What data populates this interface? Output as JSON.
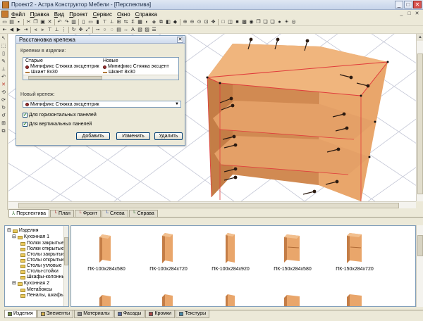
{
  "window": {
    "title": "Проект2 - Астра Конструктор Мебели - [Перспектива]",
    "buttons": {
      "minimize": "_",
      "maximize": "□",
      "close": "✕"
    }
  },
  "menu": {
    "items": [
      "Файл",
      "Правка",
      "Вид",
      "Проект",
      "Сервис",
      "Окно",
      "Справка"
    ],
    "mdi_buttons": [
      "_",
      "□",
      "✕"
    ]
  },
  "dialog": {
    "title": "Расстановка крепежа",
    "close": "✕",
    "fasteners_label": "Крепежи в изделии:",
    "columns": {
      "old": "Старые",
      "new": "Новые"
    },
    "rows": [
      {
        "old": "Минификс Стяжка эксцентрик",
        "new": "Минификс Стяжка эксцент",
        "icon": "minifix-icon"
      },
      {
        "old": "Шкант 8х30",
        "new": "Шкант 8х30",
        "icon": "dowel-icon"
      }
    ],
    "new_label": "Новый крепеж:",
    "new_value": "Минификс Стяжка эксцентрик",
    "check_horizontal": "Для горизонтальных панелей",
    "check_vertical": "Для вертикальных панелей",
    "btn_add": "Добавить",
    "btn_change": "Изменить",
    "btn_delete": "Удалить"
  },
  "view_tabs": [
    "Перспектива",
    "План",
    "Фронт",
    "Слева",
    "Справа"
  ],
  "tree": {
    "items": [
      {
        "label": "Изделия",
        "level": 0
      },
      {
        "label": "Кухонная 1",
        "level": 1
      },
      {
        "label": "Полки закрытые",
        "level": 2
      },
      {
        "label": "Полки открытые",
        "level": 2
      },
      {
        "label": "Столы закрытые",
        "level": 2
      },
      {
        "label": "Столы открытые",
        "level": 2
      },
      {
        "label": "Столы угловые",
        "level": 2
      },
      {
        "label": "Столы-стойки",
        "level": 2
      },
      {
        "label": "Шкафы-колонны",
        "level": 2
      },
      {
        "label": "Кухонная 2",
        "level": 1
      },
      {
        "label": "Метабоксы",
        "level": 2
      },
      {
        "label": "Пеналы, шкафы",
        "level": 2
      }
    ]
  },
  "gallery": {
    "items": [
      "ПК-100х284х580",
      "ПК-100х284х720",
      "ПК-100х284х920",
      "ПК-150х284х580",
      "ПК-150х284х720"
    ]
  },
  "bottom_tabs": [
    "Изделия",
    "Элементы",
    "Материалы",
    "Фасады",
    "Кромки",
    "Текстуры"
  ],
  "colors": {
    "wood": "#e9a66b",
    "wood_dark": "#c87a43",
    "selection": "#e03b3b",
    "grid": "#c4c7d6"
  }
}
